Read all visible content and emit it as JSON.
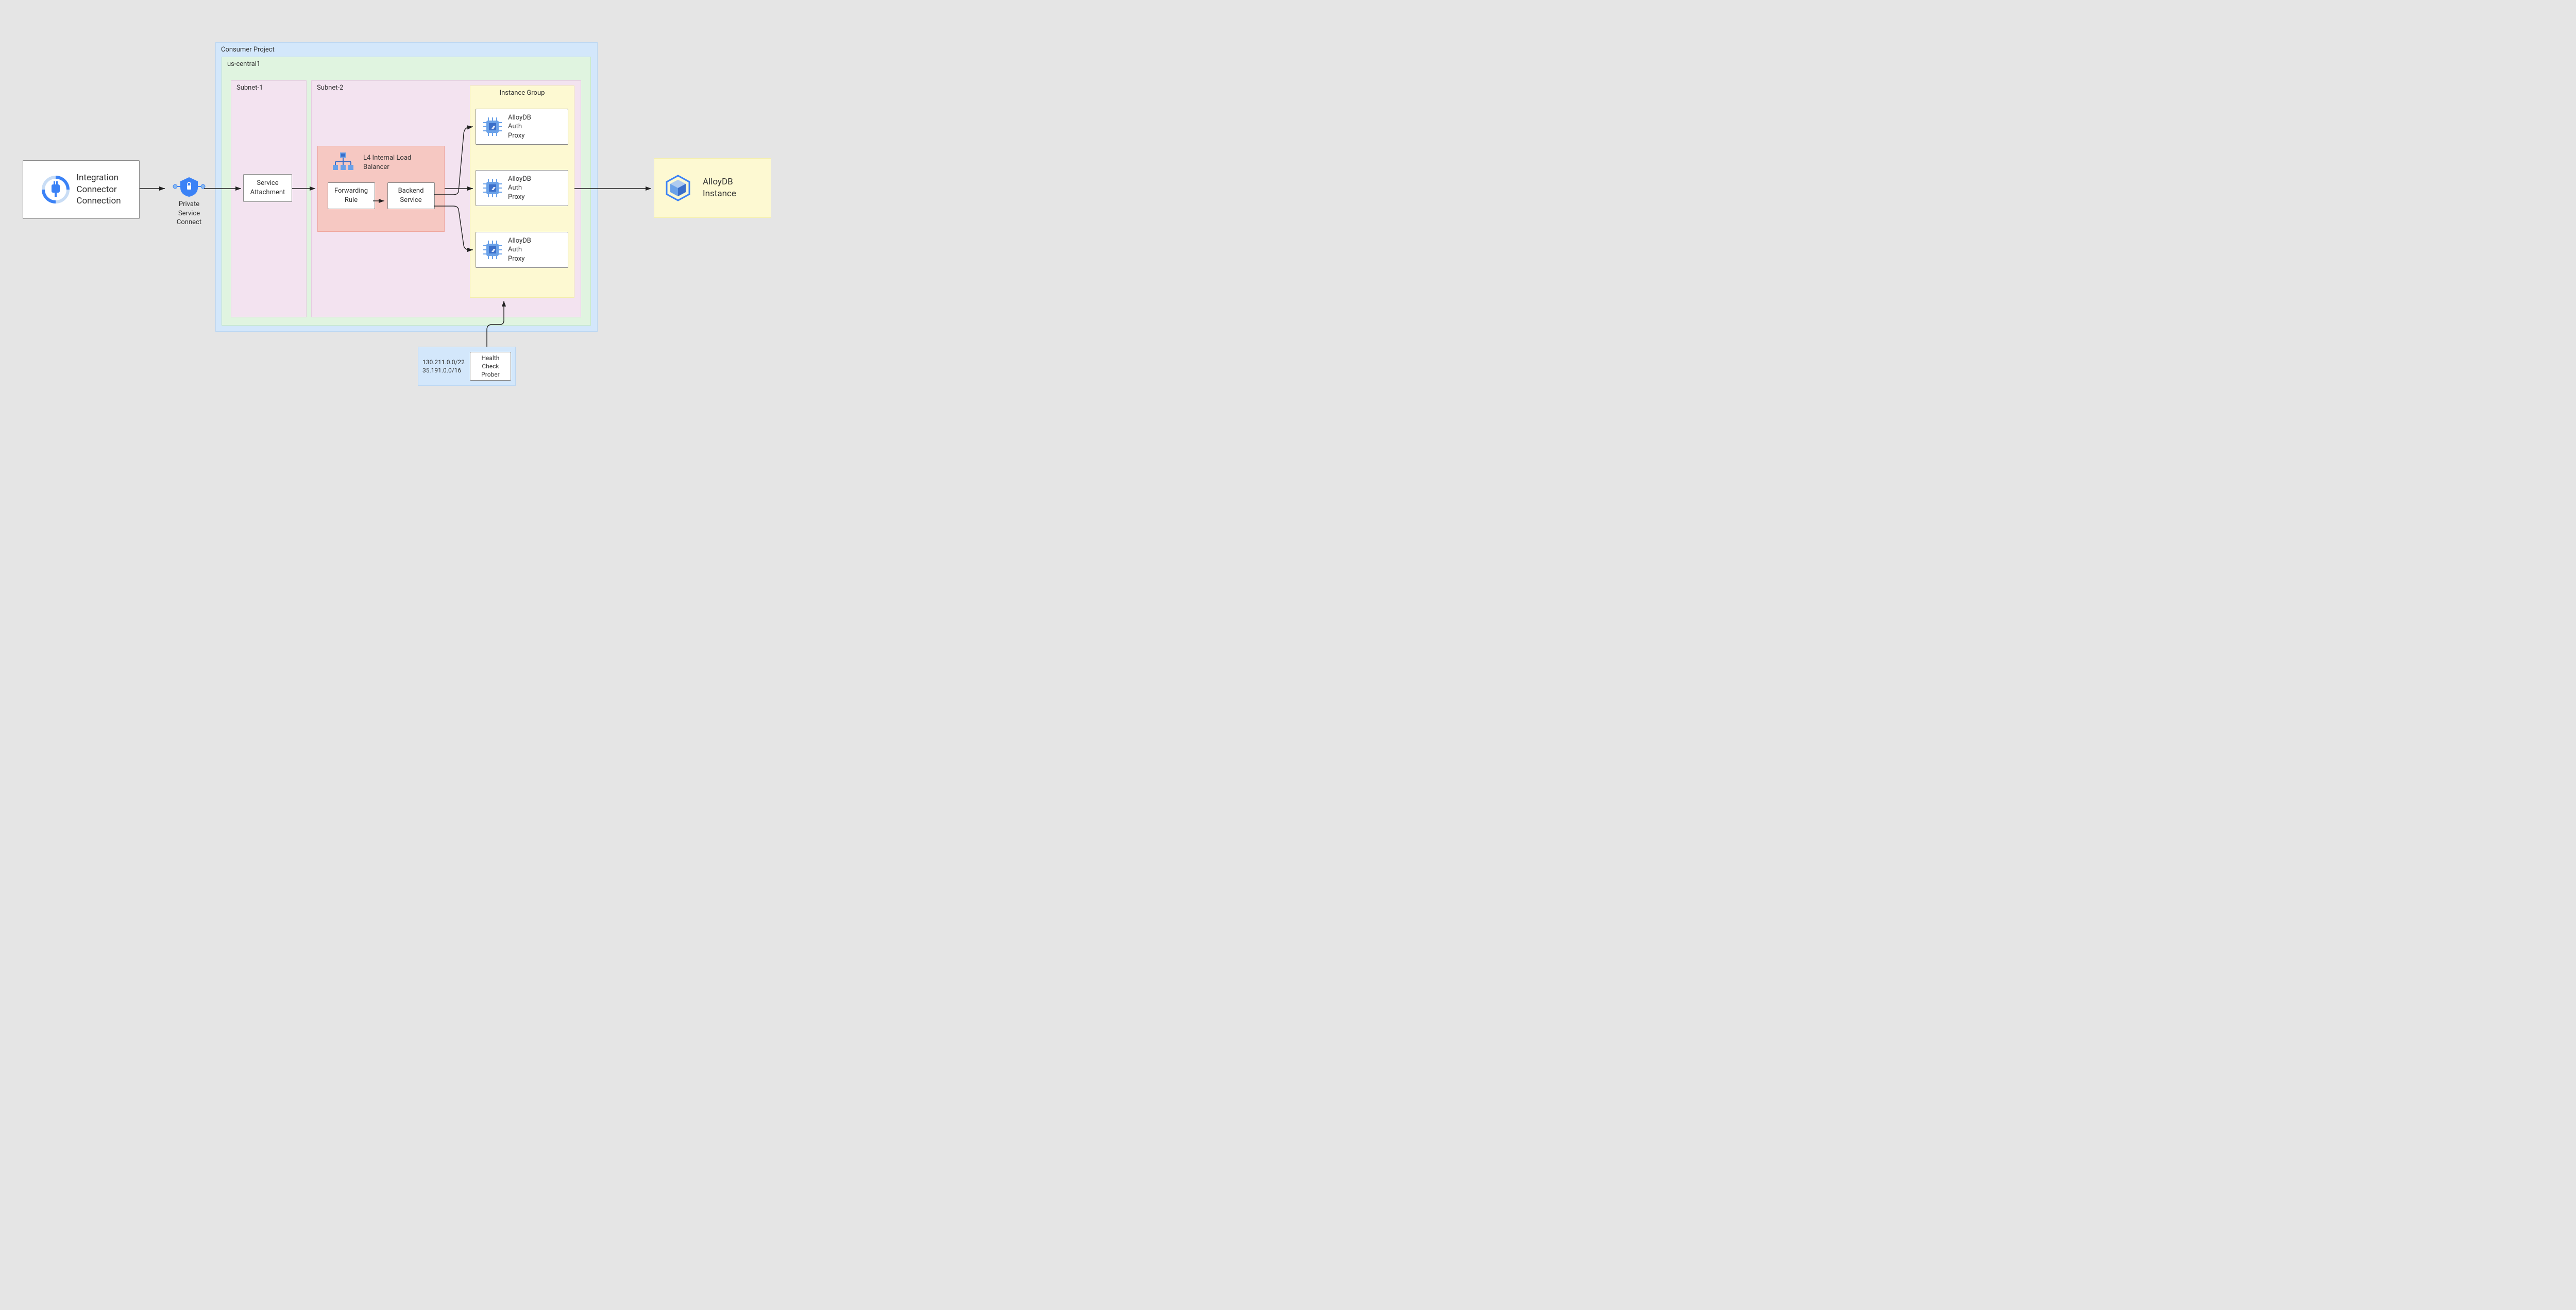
{
  "integration": {
    "label": "Integration\nConnector\nConnection"
  },
  "psc": {
    "label": "Private\nService\nConnect"
  },
  "consumer_project": {
    "label": "Consumer Project"
  },
  "region": {
    "label": "us-central1"
  },
  "subnet1": {
    "label": "Subnet-1"
  },
  "subnet2": {
    "label": "Subnet-2"
  },
  "service_attachment": {
    "label": "Service\nAttachment"
  },
  "lb": {
    "title": "L4 Internal Load\nBalancer",
    "forwarding_rule": "Forwarding\nRule",
    "backend_service": "Backend\nService"
  },
  "instance_group": {
    "label": "Instance Group",
    "proxy_label": "AlloyDB\nAuth\nProxy"
  },
  "alloydb": {
    "label": "AlloyDB\nInstance"
  },
  "health_check": {
    "ips": "130.211.0.0/22\n35.191.0.0/16",
    "label": "Health Check\nProber"
  }
}
